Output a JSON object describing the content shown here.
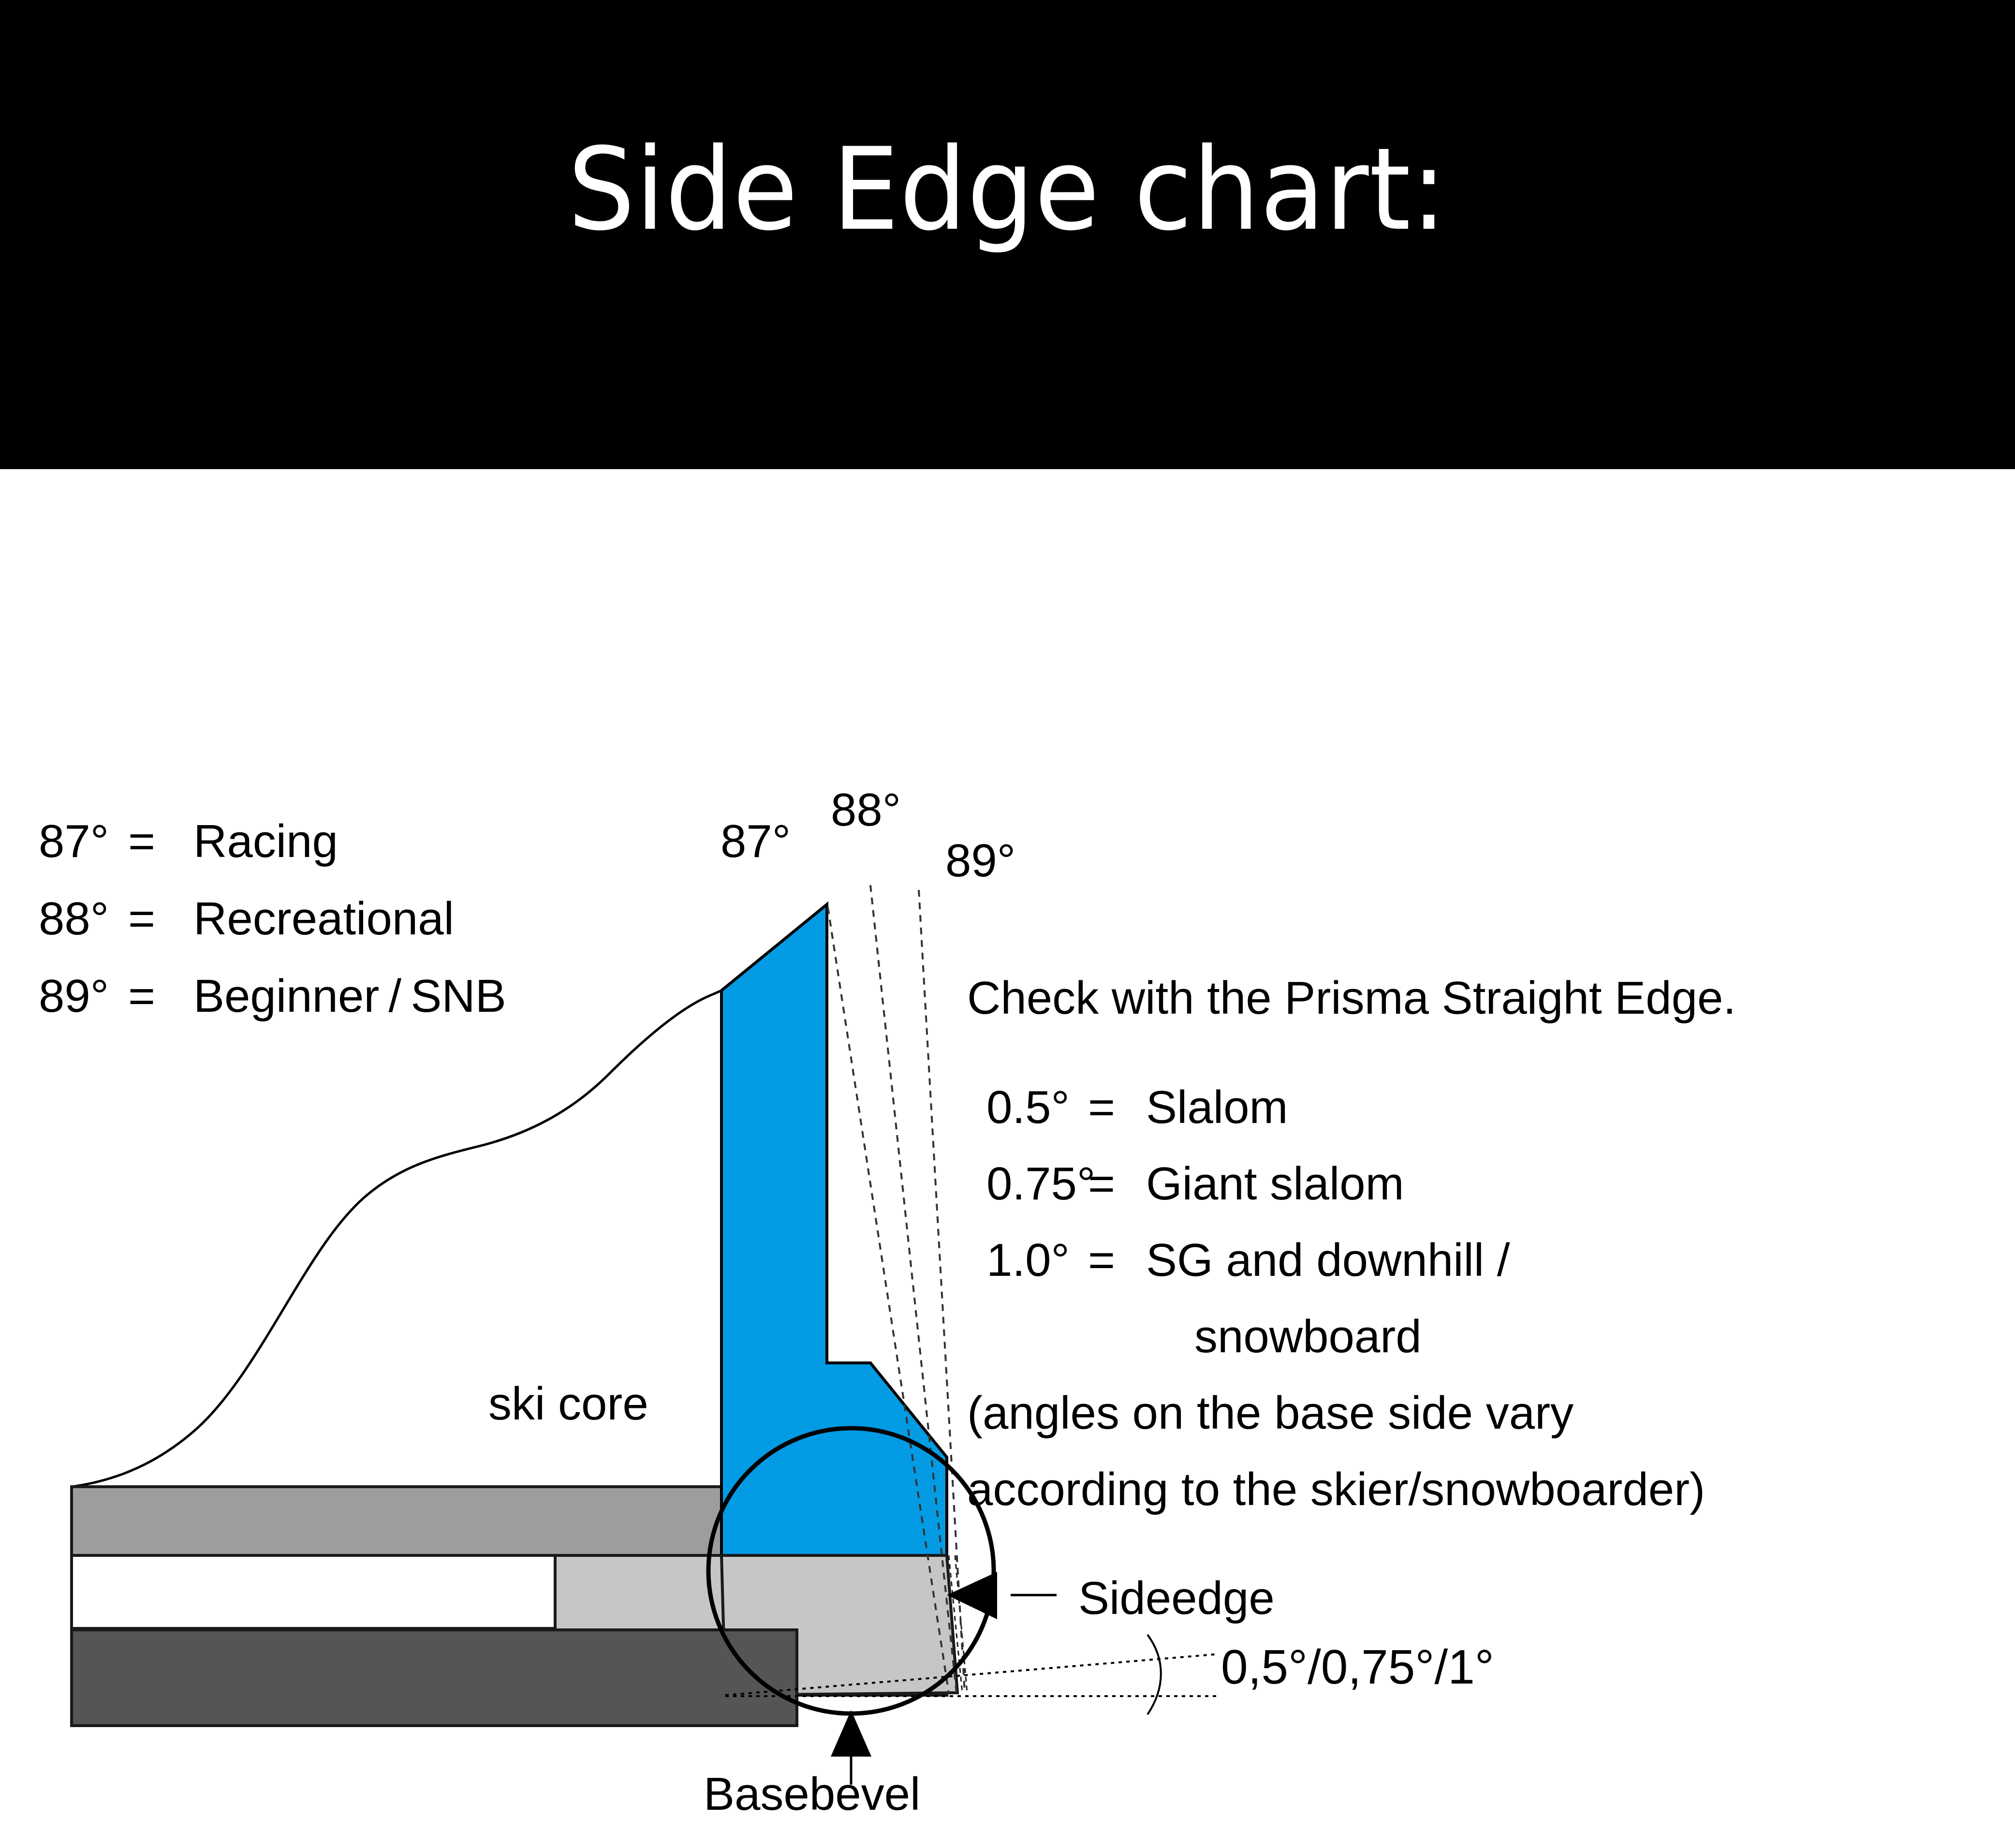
{
  "slide": {
    "title": "Side Edge chart:",
    "background": "#ffffff",
    "title_bar_color": "#000000",
    "title_text_color": "#ffffff"
  },
  "legend": {
    "rows": [
      {
        "angle": "87°",
        "eq": "=",
        "label": "Racing"
      },
      {
        "angle": "88°",
        "eq": "=",
        "label": "Recreational"
      },
      {
        "angle": "89°",
        "eq": "=",
        "label": "Beginner / SNB"
      }
    ]
  },
  "angle_callouts": [
    {
      "name": "angle-87",
      "text": "87°"
    },
    {
      "name": "angle-88",
      "text": "88°"
    },
    {
      "name": "angle-89",
      "text": "89°"
    }
  ],
  "notes": {
    "heading": "Check with the Prisma Straight Edge.",
    "rows": [
      {
        "num": "0.5°",
        "eq": "=",
        "label": "Slalom"
      },
      {
        "num": "0.75°",
        "eq": "=",
        "label": "Giant slalom"
      },
      {
        "num": "1.0°",
        "eq": "=",
        "label": "SG and downhill /"
      }
    ],
    "continuation": "snowboard",
    "paren_line1": "(angles on the base side vary",
    "paren_line2": "according to the skier/snowboarder)"
  },
  "diagram": {
    "ski_core_label": "ski core",
    "sideedge_label": "Sideedge",
    "basebevel_label": "Basebevel",
    "base_bevel_angles": "0,5°/0,75°/1°",
    "colors": {
      "core_blue": "#049BE5",
      "topsheet_gray": "#9D9D9D",
      "edge_light_gray": "#C6C6C6",
      "base_dark_gray": "#555555",
      "outline": "#000000"
    }
  },
  "chart_data": {
    "type": "diagram",
    "title": "Side Edge chart:",
    "series": [
      {
        "name": "Side edge angles",
        "categories": [
          "87°",
          "88°",
          "89°"
        ],
        "labels": [
          "Racing",
          "Recreational",
          "Beginner / SNB"
        ],
        "values": [
          87,
          88,
          89
        ]
      },
      {
        "name": "Base bevel angles",
        "categories": [
          "0.5°",
          "0.75°",
          "1.0°"
        ],
        "labels": [
          "Slalom",
          "Giant slalom",
          "SG and downhill / snowboard"
        ],
        "values": [
          0.5,
          0.75,
          1.0
        ]
      }
    ],
    "annotations": [
      "ski core",
      "Sideedge",
      "Basebevel",
      "0,5°/0,75°/1°",
      "Check with the Prisma Straight Edge.",
      "(angles on the base side vary according to the skier/snowboarder)"
    ],
    "xlabel": "",
    "ylabel": "",
    "grid": false,
    "legend_position": "left"
  }
}
